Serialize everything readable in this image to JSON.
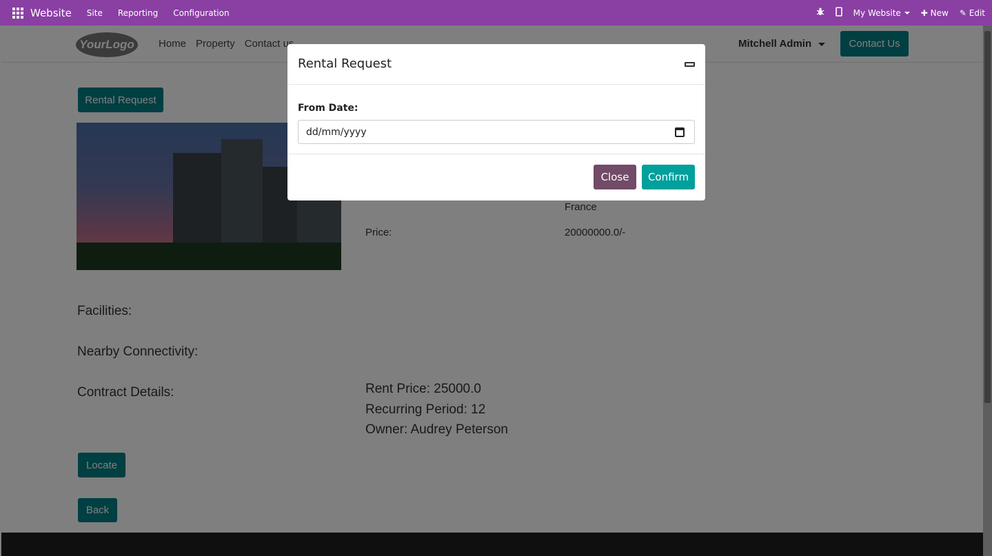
{
  "topbar": {
    "brand": "Website",
    "menus": [
      "Site",
      "Reporting",
      "Configuration"
    ],
    "my_website": "My Website",
    "new_label": "New",
    "edit_label": "Edit",
    "icons": [
      "apps-grid-icon",
      "bug-icon",
      "mobile-icon",
      "plus-icon",
      "pencil-icon"
    ]
  },
  "header": {
    "logo_text": "YourLogo",
    "nav": [
      "Home",
      "Property",
      "Contact us"
    ],
    "user": "Mitchell Admin",
    "contact_button": "Contact Us"
  },
  "property": {
    "rental_request_button": "Rental Request",
    "address_country": "France",
    "price_label": "Price:",
    "price_value": "20000000.0/-",
    "facilities_label": "Facilities:",
    "connectivity_label": "Nearby Connectivity:",
    "contract_label": "Contract Details:",
    "contract_lines": [
      "Rent Price: 25000.0",
      "Recurring Period: 12",
      "Owner: Audrey Peterson"
    ],
    "locate_button": "Locate",
    "back_button": "Back"
  },
  "modal": {
    "title": "Rental Request",
    "from_date_label": "From Date:",
    "date_placeholder": "dd/mm/yyyy",
    "close_button": "Close",
    "confirm_button": "Confirm"
  },
  "colors": {
    "topbar": "#8a3fa3",
    "primary": "#017e84",
    "close_button": "#714b67",
    "confirm_button": "#00a09d"
  }
}
